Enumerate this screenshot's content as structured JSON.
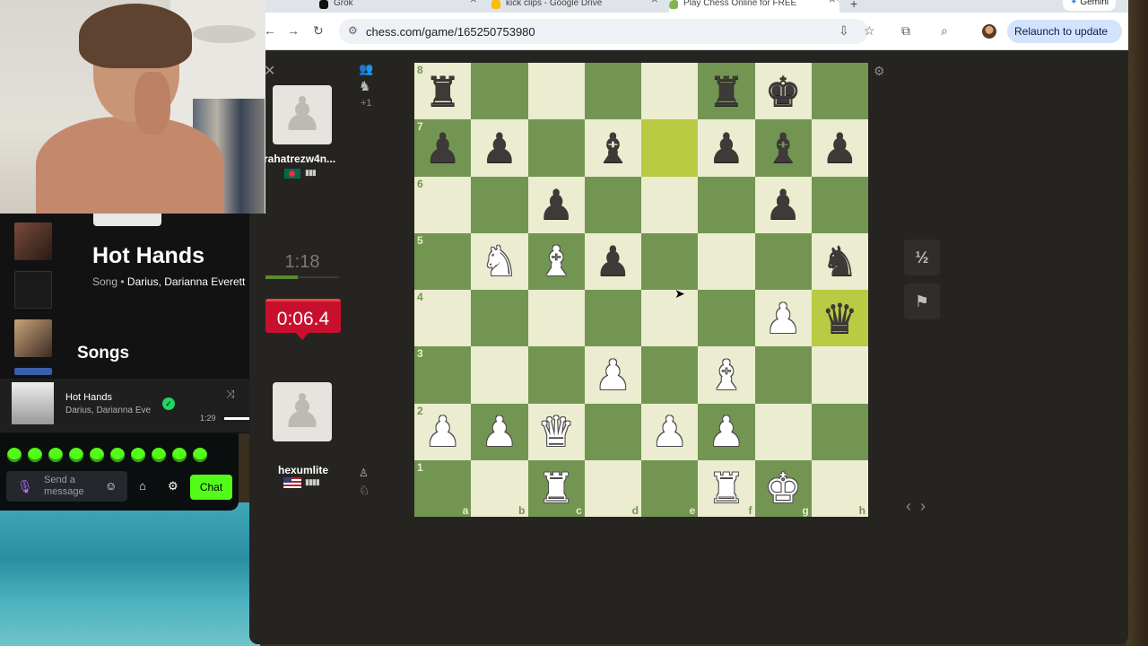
{
  "browser": {
    "tabs": [
      {
        "label": "Grok",
        "icon_color": "#111111"
      },
      {
        "label": "kick clips - Google Drive",
        "icon_color": "#fbbc04"
      },
      {
        "label": "Play Chess Online for FREE",
        "icon_color": "#81b64c"
      }
    ],
    "gemini_label": "Gemini",
    "url": "chess.com/game/165250753980",
    "relaunch_label": "Relaunch to update"
  },
  "game": {
    "opponent": {
      "name": "rahatrezw4n...",
      "country": "BD"
    },
    "me": {
      "name": "hexumlite",
      "country": "US"
    },
    "opponent_clock": "1:18",
    "my_clock": "0:06.4",
    "captured_label": "+1",
    "draw_label": "½",
    "board": [
      [
        "r",
        "",
        "",
        "",
        "",
        "r",
        "k",
        ""
      ],
      [
        "p",
        "p",
        "",
        "b",
        "",
        "p",
        "b",
        "p"
      ],
      [
        "",
        "",
        "p",
        "",
        "",
        "",
        "p",
        ""
      ],
      [
        "",
        "N",
        "B",
        "p",
        "",
        "",
        "",
        "n"
      ],
      [
        "",
        "",
        "",
        "",
        "",
        "",
        "P",
        "q"
      ],
      [
        "",
        "",
        "",
        "P",
        "",
        "B",
        "",
        ""
      ],
      [
        "P",
        "P",
        "Q",
        "",
        "P",
        "P",
        "",
        ""
      ],
      [
        "",
        "",
        "R",
        "",
        "",
        "R",
        "K",
        ""
      ]
    ],
    "highlighted": [
      "e7",
      "h4"
    ],
    "ranks": [
      "8",
      "7",
      "6",
      "5",
      "4",
      "3",
      "2",
      "1"
    ],
    "files": [
      "a",
      "b",
      "c",
      "d",
      "e",
      "f",
      "g",
      "h"
    ]
  },
  "music": {
    "title": "Hot Hands",
    "type": "Song",
    "artists": "Darius, Darianna Everett",
    "section": "Songs",
    "now_playing_title": "Hot Hands",
    "now_playing_artist": "Darius, Darianna Everett",
    "elapsed": "1:29"
  },
  "chat": {
    "placeholder_line1": "Send a",
    "placeholder_line2": "message",
    "chat_button": "Chat",
    "accent": "#53fc18"
  }
}
